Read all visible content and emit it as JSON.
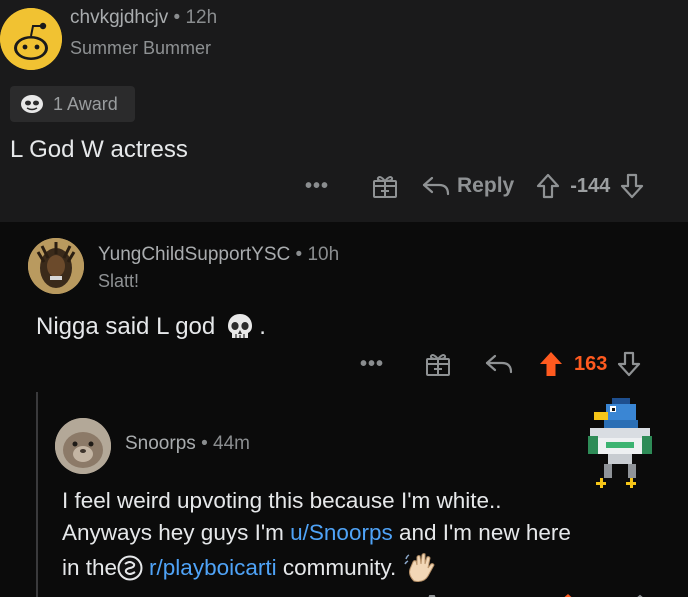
{
  "comment1": {
    "username": "chvkgjdhcjv",
    "separator": "•",
    "time": "12h",
    "flair": "Summer Bummer",
    "award_label": "1 Award",
    "body": "L God W actress",
    "actions": {
      "more": "•••",
      "reply": "Reply",
      "score": "-144"
    }
  },
  "comment2": {
    "username": "YungChildSupportYSC",
    "separator": "•",
    "time": "10h",
    "flair": "Slatt!",
    "body_prefix": "Nigga said L god",
    "body_suffix": ".",
    "actions": {
      "more": "•••",
      "score": "163"
    }
  },
  "comment3": {
    "username": "Snoorps",
    "separator": "•",
    "time": "44m",
    "line1": "I feel weird upvoting this because I'm white..",
    "line2_pre": "Anyways hey guys I'm ",
    "line2_link": "u/Snoorps",
    "line2_post": " and I'm new here",
    "line3_pre": "in the ",
    "line3_link": "r/playboicarti",
    "line3_post": " community."
  },
  "colors": {
    "upvote_active": "#ff5a1f",
    "link": "#4fa3f7",
    "snoo_yellow": "#f1c232"
  }
}
